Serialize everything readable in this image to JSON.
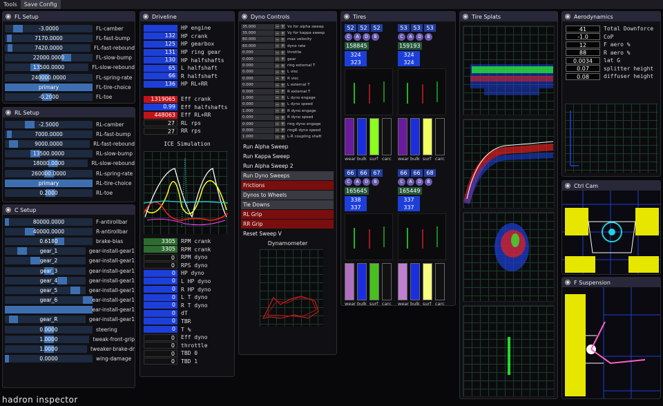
{
  "menu": [
    "Tools",
    "Save Config"
  ],
  "brand": "hadron inspector",
  "fl": {
    "title": "FL Setup",
    "rows": [
      {
        "v": "-3.0000",
        "l": "FL-camber",
        "f": 0.15
      },
      {
        "v": "7170.0000",
        "l": "FL-fast-bump",
        "f": 0.05
      },
      {
        "v": "7420.0000",
        "l": "FL-fast-rebound",
        "f": 0.06
      },
      {
        "v": "22000.0000",
        "l": "FL-slow-bump",
        "f": 0.7
      },
      {
        "v": "13500.0000",
        "l": "FL-slow-rebound",
        "f": 0.35
      },
      {
        "v": "240000.0000",
        "l": "FL-spring-rate",
        "f": 0.45
      },
      {
        "v": "primary",
        "l": "FL-tire-choice",
        "f": 1.0
      },
      {
        "v": "-0.2000",
        "l": "FL-toe",
        "f": 0.48
      }
    ]
  },
  "rl": {
    "title": "RL Setup",
    "rows": [
      {
        "v": "-2.5000",
        "l": "RL-camber",
        "f": 0.28
      },
      {
        "v": "7000.0000",
        "l": "RL-fast-bump",
        "f": 0.05
      },
      {
        "v": "9000.0000",
        "l": "RL-fast-rebound",
        "f": 0.1
      },
      {
        "v": "13500.0000",
        "l": "RL-slow-bump",
        "f": 0.35
      },
      {
        "v": "18000.0000",
        "l": "RL-slow-rebound",
        "f": 0.55
      },
      {
        "v": "260000.0000",
        "l": "RL-spring-rate",
        "f": 0.5
      },
      {
        "v": "primary",
        "l": "RL-tire-choice",
        "f": 1.0
      },
      {
        "v": "0.2000",
        "l": "RL-toe",
        "f": 0.52
      }
    ]
  },
  "c": {
    "title": "C Setup",
    "rows": [
      {
        "v": "80000.0000",
        "l": "F-antirollbar",
        "f": 0.02
      },
      {
        "v": "40000.0000",
        "l": "R-antirollbar",
        "f": 0.28
      },
      {
        "v": "0.6180",
        "l": "brake-bias",
        "f": 0.62
      },
      {
        "v": "gear_1",
        "l": "gear-install-gear1",
        "f": 0.2
      },
      {
        "v": "gear_2",
        "l": "gear-install-gear1",
        "f": 0.35
      },
      {
        "v": "gear_3",
        "l": "gear-install-gear1",
        "f": 0.5
      },
      {
        "v": "gear_4",
        "l": "gear-install-gear1",
        "f": 0.65
      },
      {
        "v": "gear_5",
        "l": "gear-install-gear1",
        "f": 0.8
      },
      {
        "v": "gear_6",
        "l": "gear-install-gear1",
        "f": 0.95
      },
      {
        "v": "",
        "l": "gear-install-gear1",
        "f": 1.0
      },
      {
        "v": "gear_R",
        "l": "gear-install-gear1",
        "f": 0.1
      },
      {
        "v": "0.0000",
        "l": "steering",
        "f": 0.5
      },
      {
        "v": "1.0000",
        "l": "tweak-front-grip",
        "f": 0.5
      },
      {
        "v": "1.0000",
        "l": "tweaker-brake-dr",
        "f": 0.5
      },
      {
        "v": "0.0000",
        "l": "wing-damage",
        "f": 0.02
      }
    ]
  },
  "drive": {
    "title": "Driveline",
    "rows1": [
      {
        "v": "",
        "l": "HP engine",
        "c": "blue"
      },
      {
        "v": "132",
        "l": "HP crank",
        "c": "blue"
      },
      {
        "v": "125",
        "l": "HP gearbox",
        "c": "blue"
      },
      {
        "v": "131",
        "l": "HP ring gear",
        "c": "blue"
      },
      {
        "v": "130",
        "l": "HP halfshafts",
        "c": "blue"
      },
      {
        "v": "65",
        "l": "L halfshaft",
        "c": "blue"
      },
      {
        "v": "66",
        "l": "R halfshaft",
        "c": "blue"
      },
      {
        "v": "136",
        "l": "HP RL+RR",
        "c": "blue"
      }
    ],
    "rows2": [
      {
        "v": "1319065",
        "l": "Eff crank",
        "c": "red"
      },
      {
        "v": "0.99",
        "l": "Eff halfshafts",
        "c": "blue"
      },
      {
        "v": "448063",
        "l": "Eff RL+RR",
        "c": "red"
      },
      {
        "v": "27",
        "l": "RL rps",
        "c": "dark"
      },
      {
        "v": "27",
        "l": "RR rps",
        "c": "dark"
      }
    ],
    "sim_title": "ICE Simulation",
    "rows3": [
      {
        "v": "3305",
        "l": "RPM crank",
        "c": "green"
      },
      {
        "v": "3305",
        "l": "RPM crank",
        "c": "green"
      },
      {
        "v": "0",
        "l": "RPM dyno",
        "c": "dark"
      },
      {
        "v": "0",
        "l": "RPS dyno",
        "c": "dark"
      },
      {
        "v": "0",
        "l": "HP dyno",
        "c": "blue"
      },
      {
        "v": "0",
        "l": "L HP dyno",
        "c": "blue"
      },
      {
        "v": "0",
        "l": "R HP dyno",
        "c": "blue"
      },
      {
        "v": "0",
        "l": "L T dyno",
        "c": "blue"
      },
      {
        "v": "0",
        "l": "R T dyno",
        "c": "blue"
      },
      {
        "v": "0",
        "l": "dT",
        "c": "blue"
      },
      {
        "v": "0",
        "l": "TBR",
        "c": "blue"
      },
      {
        "v": "0",
        "l": "T %",
        "c": "blue"
      },
      {
        "v": "0",
        "l": "Eff dyno",
        "c": "dark"
      },
      {
        "v": "0",
        "l": "throttle",
        "c": "dark"
      },
      {
        "v": "0",
        "l": "TBD 0",
        "c": "dark"
      },
      {
        "v": "0",
        "l": "TBD 1",
        "c": "dark"
      }
    ]
  },
  "dyno": {
    "title": "Dyno Controls",
    "controls": [
      {
        "v": "35.000",
        "l": "Vx for alpha sweep"
      },
      {
        "v": "35.000",
        "l": "Vy for kappa sweep"
      },
      {
        "v": "80.000",
        "l": "max velocity"
      },
      {
        "v": "60.000",
        "l": "dyno rate"
      },
      {
        "v": "0.000",
        "l": "throttle"
      },
      {
        "v": "0.000",
        "l": "gear"
      },
      {
        "v": "0.000",
        "l": "ring external T"
      },
      {
        "v": "0.000",
        "l": "L visc"
      },
      {
        "v": "0.000",
        "l": "R visc"
      },
      {
        "v": "0.000",
        "l": "L external T"
      },
      {
        "v": "0.000",
        "l": "R external T"
      },
      {
        "v": "1.000",
        "l": "L dyno engage"
      },
      {
        "v": "0.000",
        "l": "L dyno speed"
      },
      {
        "v": "1.000",
        "l": "R dyno engage"
      },
      {
        "v": "0.000",
        "l": "R dyno speed"
      },
      {
        "v": "0.000",
        "l": "ring dyno engage"
      },
      {
        "v": "0.000",
        "l": "ringR dyno speed"
      },
      {
        "v": "1.000",
        "l": "L-R coupling shaft"
      }
    ],
    "actions": [
      {
        "l": "Run Alpha Sweep",
        "s": ""
      },
      {
        "l": "Run Kappa Sweep",
        "s": ""
      },
      {
        "l": "Run Alpha Sweep 2",
        "s": ""
      },
      {
        "l": "Run Dyno Sweeps",
        "s": "hl"
      },
      {
        "l": "Frictions",
        "s": "rd"
      },
      {
        "l": "Dynos to Wheels",
        "s": "hl"
      },
      {
        "l": "Tie Downs",
        "s": "hl"
      },
      {
        "l": "RL Grip",
        "s": "rd"
      },
      {
        "l": "RR Grip",
        "s": "rd"
      },
      {
        "l": "Reset Sweep V",
        "s": ""
      }
    ],
    "dyn_title": "Dynamometer"
  },
  "tires": {
    "title": "Tires",
    "wheels": [
      {
        "n": [
          "52",
          "52",
          "52"
        ],
        "g": "158845",
        "b": [
          "324",
          "323"
        ],
        "t": [
          "66",
          "66",
          "67"
        ],
        "cols": [
          "#6a1a9c",
          "#1a2ee0",
          "#8cff20",
          "#111"
        ]
      },
      {
        "n": [
          "53",
          "53",
          "53"
        ],
        "g": "159193",
        "b": [
          "324",
          "324"
        ],
        "t": [
          "67",
          "66",
          "68"
        ],
        "cols": [
          "#6a1a9c",
          "#1a2ee0",
          "#f4ff60",
          "#111"
        ]
      },
      {
        "n": [
          "66",
          "66",
          "67"
        ],
        "g": "165645",
        "b": [
          "338",
          "337"
        ],
        "t": [
          "",
          "",
          ""
        ],
        "cols": [
          "#b070c0",
          "#1a2ee0",
          "#48c020",
          "#111"
        ]
      },
      {
        "n": [
          "66",
          "66",
          "68"
        ],
        "g": "165449",
        "b": [
          "337",
          "337"
        ],
        "t": [
          "",
          "",
          ""
        ],
        "cols": [
          "#c080d0",
          "#1a2ee0",
          "#f6ff80",
          "#111"
        ]
      }
    ],
    "circles": [
      "C",
      "A",
      "D",
      "B"
    ],
    "bar_labels": [
      "wear",
      "bulk",
      "surf",
      "carc"
    ]
  },
  "splats": {
    "title": "Tire Splats"
  },
  "aero": {
    "title": "Aerodynamics",
    "rows": [
      {
        "v": "41",
        "l": "Total Downforce"
      },
      {
        "v": "-1.0",
        "l": "CoP"
      },
      {
        "v": "12",
        "l": "F aero %"
      },
      {
        "v": "88",
        "l": "R aero %"
      },
      {
        "v": "0.0034",
        "l": "lat G"
      },
      {
        "v": "0.07",
        "l": "splitter height"
      },
      {
        "v": "0.08",
        "l": "diffuser height"
      }
    ]
  },
  "ctrl": {
    "title": "Ctrl Cam"
  },
  "fsusp": {
    "title": "F Suspension"
  }
}
